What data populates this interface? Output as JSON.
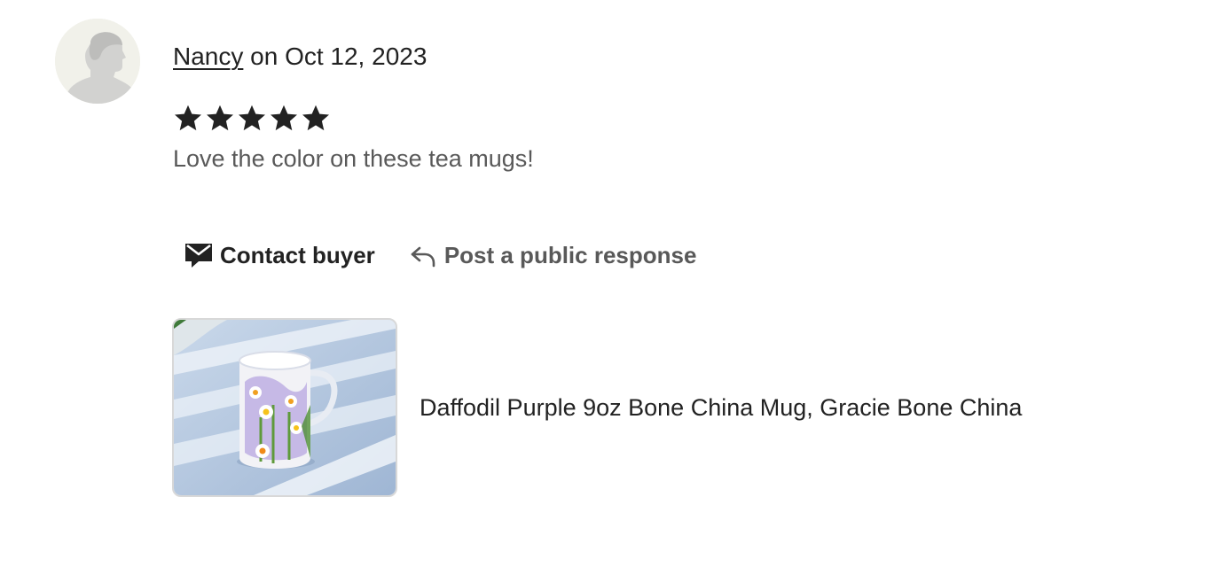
{
  "review": {
    "reviewer_name": "Nancy",
    "date_text": " on Oct 12, 2023",
    "rating": 5,
    "max_rating": 5,
    "text": "Love the color on these tea mugs!"
  },
  "actions": {
    "contact_label": "Contact buyer",
    "respond_label": "Post a public response"
  },
  "listing": {
    "title": "Daffodil Purple 9oz Bone China Mug, Gracie Bone China"
  },
  "colors": {
    "text_primary": "#222222",
    "text_secondary": "#595959",
    "avatar_bg": "#f1f1ea",
    "star": "#222222"
  }
}
